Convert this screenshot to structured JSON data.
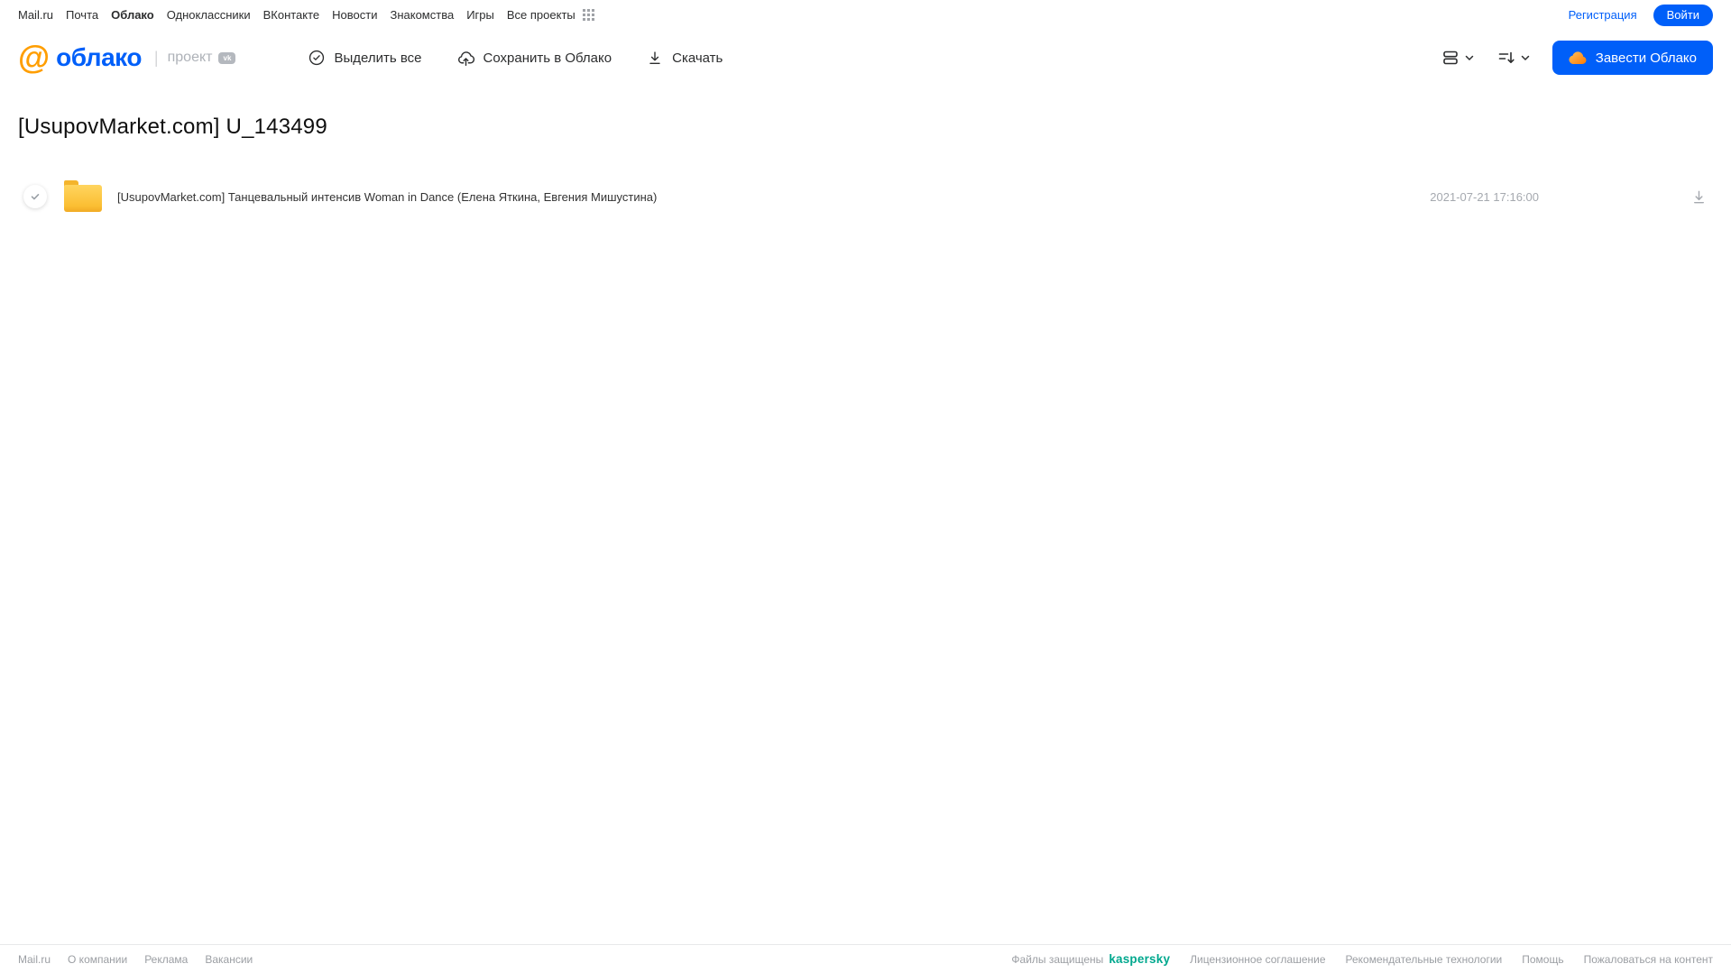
{
  "colors": {
    "accent_blue": "#005FF9",
    "logo_orange": "#FF9E00",
    "folder_yellow": "#FBBE33",
    "kaspersky_teal": "#00A88E",
    "text_dark": "#2C2D2E",
    "text_muted": "#A5A9AF"
  },
  "icons": {
    "app-grid-icon": "3x3 dots",
    "select-all-icon": "check in circle",
    "save-to-cloud-icon": "cloud with up arrow",
    "download-icon": "down arrow with baseline",
    "list-view-icon": "two stacked rounded rectangles",
    "chevron-down-icon": "chevron down",
    "sort-icon": "lines with down arrow",
    "cloud-icon": "orange cloud",
    "folder-icon": "yellow folder",
    "vk-icon": "vk badge",
    "at-logo-icon": "orange @ mail.ru mark"
  },
  "topnav": {
    "items": [
      "Mail.ru",
      "Почта",
      "Облако",
      "Одноклассники",
      "ВКонтакте",
      "Новости",
      "Знакомства",
      "Игры",
      "Все проекты"
    ],
    "registration_label": "Регистрация",
    "login_label": "Войти"
  },
  "header": {
    "logo_at": "@",
    "logo_text": "облако",
    "project_label": "проект",
    "vk_badge": "vk",
    "select_all_label": "Выделить все",
    "save_to_cloud_label": "Сохранить в Облако",
    "download_label": "Скачать",
    "create_cloud_label": "Завести Облако"
  },
  "page": {
    "title": "[UsupovMarket.com] U_143499"
  },
  "files": [
    {
      "name": "[UsupovMarket.com] Танцевальный интенсив Woman in Dance (Елена Яткина, Евгения Мишустина)",
      "date": "2021-07-21 17:16:00"
    }
  ],
  "footer": {
    "left_items": [
      "Mail.ru",
      "О компании",
      "Реклама",
      "Вакансии"
    ],
    "protected_label": "Файлы защищены",
    "kaspersky_label": "kaspersky",
    "right_items": [
      "Лицензионное соглашение",
      "Рекомендательные технологии",
      "Помощь",
      "Пожаловаться на контент"
    ]
  }
}
